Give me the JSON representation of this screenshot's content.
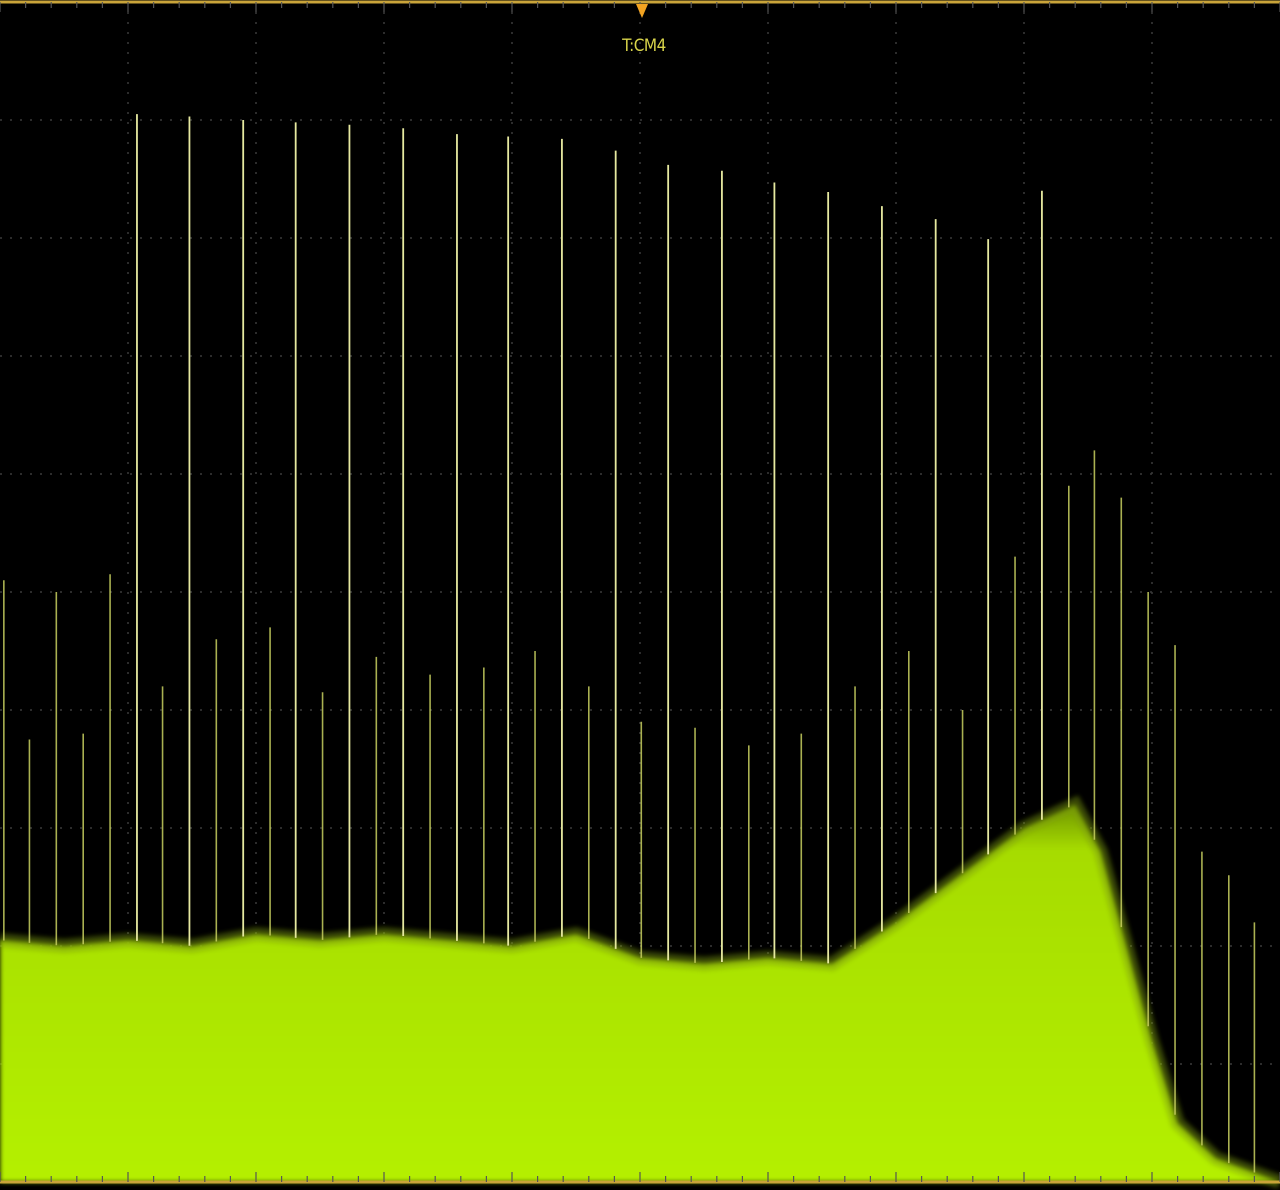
{
  "colors": {
    "background": "#000000",
    "trace": "#b4f000",
    "grid": "#3a3a3a",
    "frame": "#c9a43a",
    "marker": "#f2a321",
    "marker_label": "#d8d44a"
  },
  "marker": {
    "label": "T:CM4"
  },
  "chart_data": {
    "type": "area",
    "grid": true,
    "xlim": [
      0,
      1
    ],
    "ylim": [
      0,
      1
    ],
    "divisions": {
      "x": 10,
      "y": 10
    },
    "noise_floor": {
      "x": [
        0,
        0.05,
        0.1,
        0.15,
        0.2,
        0.25,
        0.3,
        0.35,
        0.4,
        0.45,
        0.5,
        0.55,
        0.6,
        0.65,
        0.7,
        0.75,
        0.8,
        0.82,
        0.84,
        0.86,
        0.88,
        0.9,
        0.92,
        0.95,
        1.0
      ],
      "y": [
        0.205,
        0.2,
        0.205,
        0.2,
        0.21,
        0.205,
        0.21,
        0.205,
        0.2,
        0.21,
        0.19,
        0.185,
        0.19,
        0.185,
        0.22,
        0.26,
        0.3,
        0.31,
        0.32,
        0.28,
        0.2,
        0.12,
        0.05,
        0.02,
        0.0
      ]
    },
    "dominant_spikes": {
      "x": [
        0.107,
        0.148,
        0.19,
        0.231,
        0.273,
        0.315,
        0.357,
        0.397,
        0.439,
        0.481,
        0.522,
        0.564,
        0.605,
        0.647,
        0.689,
        0.731,
        0.772,
        0.814
      ],
      "y": [
        0.905,
        0.903,
        0.9,
        0.898,
        0.896,
        0.893,
        0.888,
        0.886,
        0.884,
        0.874,
        0.862,
        0.857,
        0.847,
        0.839,
        0.827,
        0.816,
        0.799,
        0.84
      ]
    },
    "secondary_spikes": {
      "x": [
        0.003,
        0.023,
        0.044,
        0.065,
        0.086,
        0.127,
        0.169,
        0.211,
        0.252,
        0.294,
        0.336,
        0.378,
        0.418,
        0.46,
        0.501,
        0.543,
        0.585,
        0.626,
        0.668,
        0.71,
        0.752,
        0.793,
        0.835,
        0.855,
        0.876,
        0.897,
        0.918,
        0.939,
        0.96,
        0.98
      ],
      "y": [
        0.51,
        0.375,
        0.5,
        0.38,
        0.515,
        0.42,
        0.46,
        0.47,
        0.415,
        0.445,
        0.43,
        0.436,
        0.45,
        0.42,
        0.39,
        0.385,
        0.37,
        0.38,
        0.42,
        0.45,
        0.4,
        0.53,
        0.59,
        0.62,
        0.58,
        0.5,
        0.455,
        0.28,
        0.26,
        0.22
      ]
    }
  }
}
